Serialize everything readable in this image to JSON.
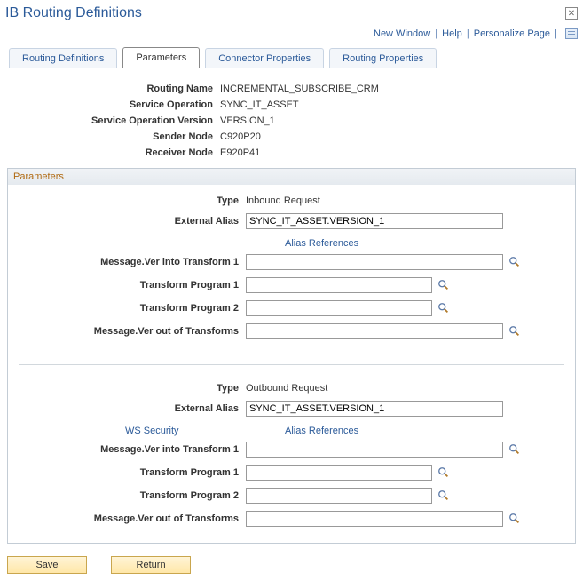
{
  "title": "IB Routing Definitions",
  "topLinks": {
    "newWindow": "New Window",
    "help": "Help",
    "personalize": "Personalize Page"
  },
  "tabs": [
    {
      "label": "Routing Definitions",
      "active": false
    },
    {
      "label": "Parameters",
      "active": true
    },
    {
      "label": "Connector Properties",
      "active": false
    },
    {
      "label": "Routing Properties",
      "active": false
    }
  ],
  "header": {
    "routingNameLabel": "Routing Name",
    "routingName": "INCREMENTAL_SUBSCRIBE_CRM",
    "serviceOperationLabel": "Service Operation",
    "serviceOperation": "SYNC_IT_ASSET",
    "serviceOperationVersionLabel": "Service Operation Version",
    "serviceOperationVersion": "VERSION_1",
    "senderNodeLabel": "Sender Node",
    "senderNode": "C920P20",
    "receiverNodeLabel": "Receiver Node",
    "receiverNode": "E920P41"
  },
  "group": {
    "title": "Parameters",
    "inbound": {
      "typeLabel": "Type",
      "type": "Inbound Request",
      "externalAliasLabel": "External Alias",
      "externalAlias": "SYNC_IT_ASSET.VERSION_1",
      "aliasReferences": "Alias References",
      "msgVerInLabel": "Message.Ver into Transform 1",
      "msgVerIn": "",
      "transform1Label": "Transform Program 1",
      "transform1": "",
      "transform2Label": "Transform Program 2",
      "transform2": "",
      "msgVerOutLabel": "Message.Ver out of Transforms",
      "msgVerOut": ""
    },
    "outbound": {
      "typeLabel": "Type",
      "type": "Outbound Request",
      "externalAliasLabel": "External Alias",
      "externalAlias": "SYNC_IT_ASSET.VERSION_1",
      "wsSecurity": "WS Security",
      "aliasReferences": "Alias References",
      "msgVerInLabel": "Message.Ver into Transform 1",
      "msgVerIn": "",
      "transform1Label": "Transform Program 1",
      "transform1": "",
      "transform2Label": "Transform Program 2",
      "transform2": "",
      "msgVerOutLabel": "Message.Ver out of Transforms",
      "msgVerOut": ""
    }
  },
  "buttons": {
    "save": "Save",
    "return": "Return"
  }
}
